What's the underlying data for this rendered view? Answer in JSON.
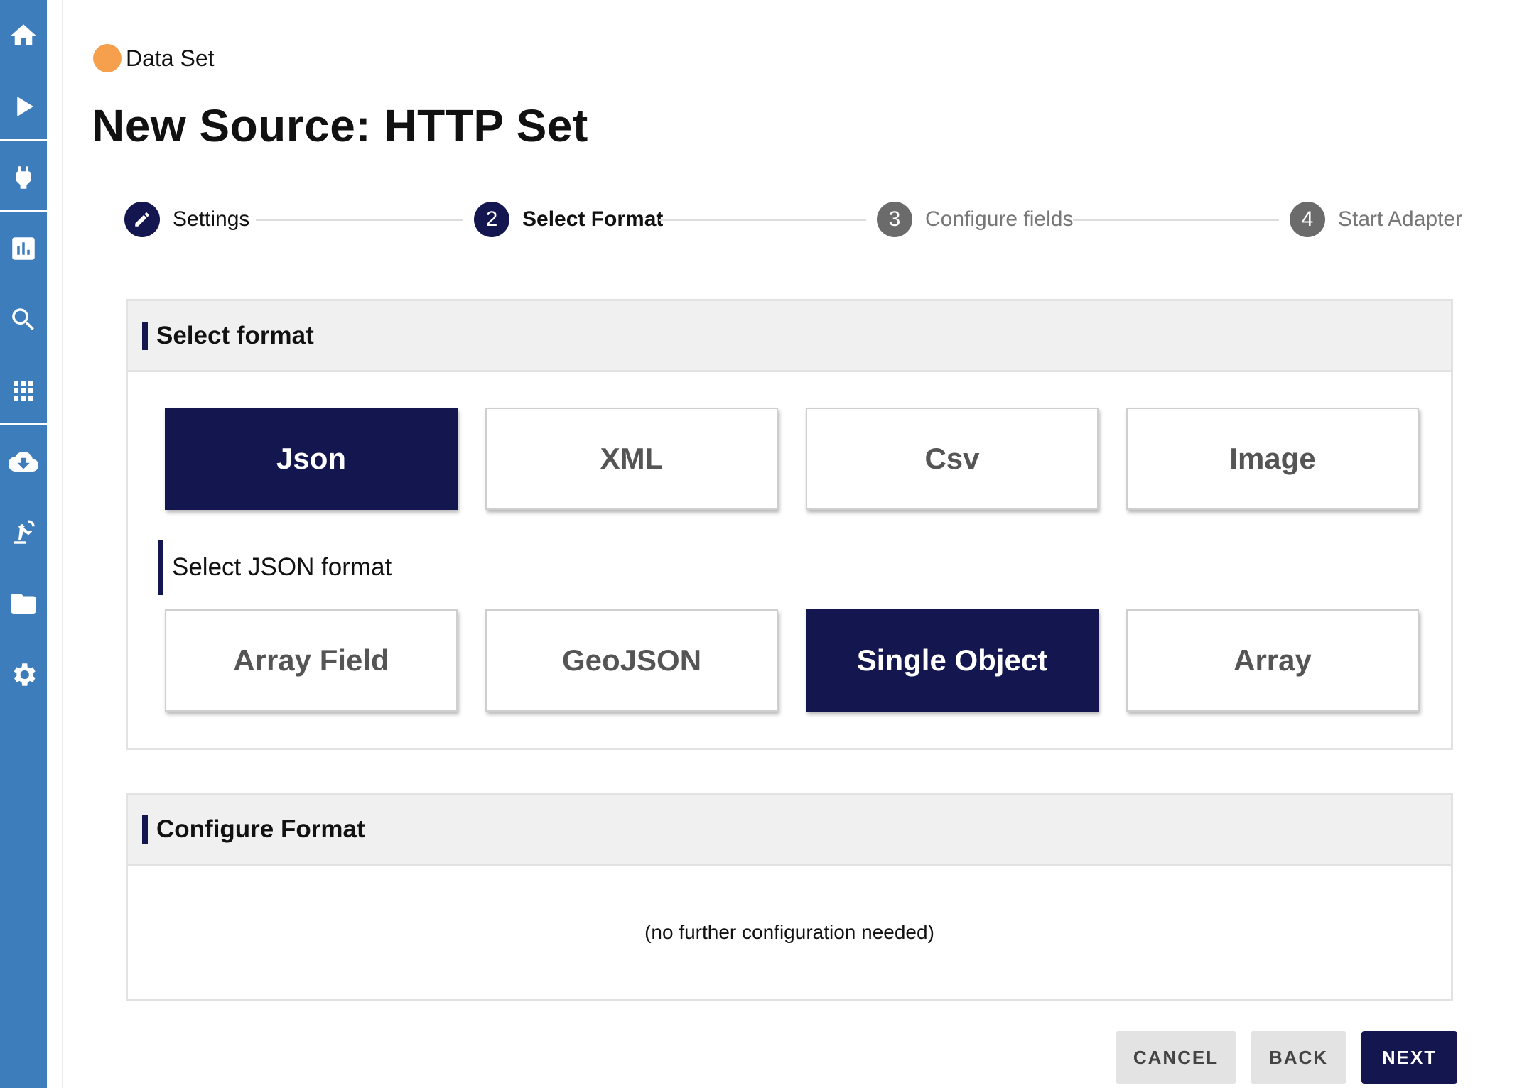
{
  "sidebar": {
    "items": [
      {
        "name": "home-icon",
        "icon": "home"
      },
      {
        "name": "play-icon",
        "icon": "play"
      },
      {
        "name": "plug-icon",
        "icon": "plug"
      },
      {
        "name": "chart-icon",
        "icon": "bar-chart"
      },
      {
        "name": "search-icon",
        "icon": "search"
      },
      {
        "name": "apps-grid-icon",
        "icon": "grid"
      },
      {
        "name": "cloud-download-icon",
        "icon": "cloud-download"
      },
      {
        "name": "robot-arm-icon",
        "icon": "robot-arm"
      },
      {
        "name": "folder-icon",
        "icon": "folder"
      },
      {
        "name": "gear-icon",
        "icon": "gear"
      }
    ],
    "color": "#3e7dbc"
  },
  "header": {
    "breadcrumb": "Data Set",
    "title": "New Source: HTTP Set"
  },
  "stepper": {
    "steps": [
      {
        "number": "",
        "label": "Settings",
        "state": "done"
      },
      {
        "number": "2",
        "label": "Select Format",
        "state": "active"
      },
      {
        "number": "3",
        "label": "Configure fields",
        "state": "idle"
      },
      {
        "number": "4",
        "label": "Start Adapter",
        "state": "idle"
      }
    ]
  },
  "format_panel": {
    "title": "Select format",
    "formats": [
      "Json",
      "XML",
      "Csv",
      "Image"
    ],
    "selected_format": "Json",
    "json_subtitle": "Select JSON format",
    "json_formats": [
      "Array Field",
      "GeoJSON",
      "Single Object",
      "Array"
    ],
    "selected_json_format": "Single Object"
  },
  "config_panel": {
    "title": "Configure Format",
    "message": "(no further configuration needed)"
  },
  "footer": {
    "cancel_label": "CANCEL",
    "back_label": "BACK",
    "next_label": "NEXT"
  },
  "colors": {
    "primary": "#13164f",
    "accent_orange": "#f6a04d"
  }
}
